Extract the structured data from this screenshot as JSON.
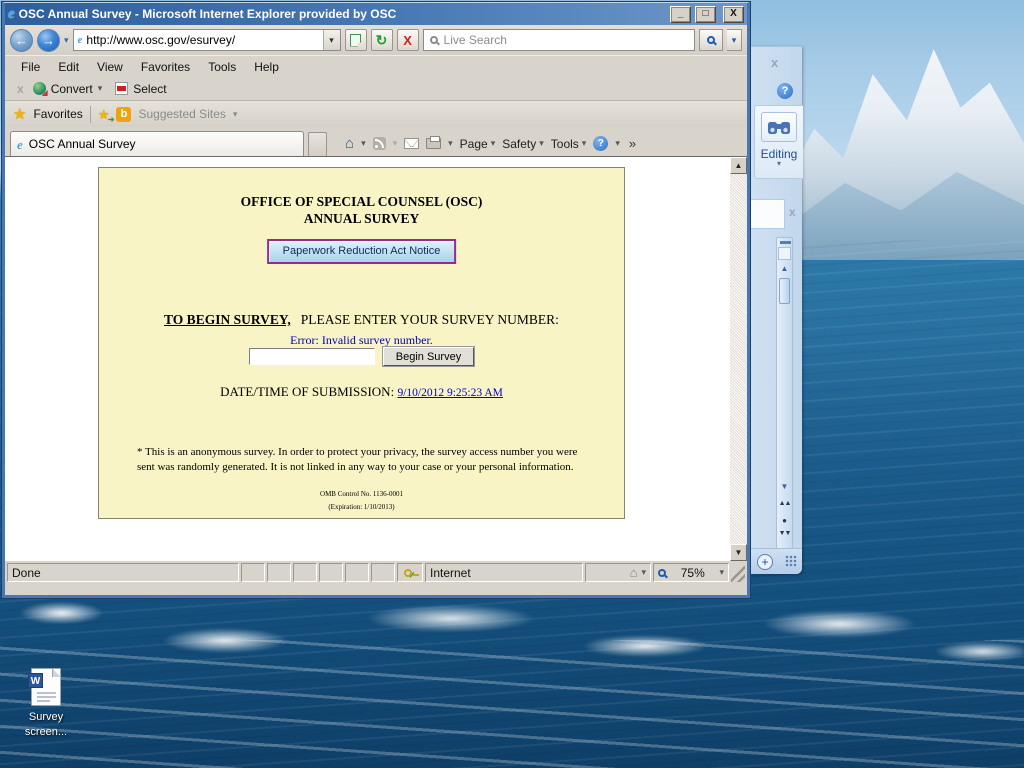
{
  "window": {
    "title": "OSC Annual Survey - Microsoft Internet Explorer provided by OSC",
    "minimize_glyph": "_",
    "maximize_glyph": "□",
    "close_glyph": "X"
  },
  "address_bar": {
    "url": "http://www.osc.gov/esurvey/",
    "search_placeholder": "Live Search",
    "back_glyph": "←",
    "forward_glyph": "→",
    "refresh_glyph": "↻",
    "stop_glyph": "X",
    "caret_glyph": "▾"
  },
  "menu": {
    "items": [
      "File",
      "Edit",
      "View",
      "Favorites",
      "Tools",
      "Help"
    ]
  },
  "convert_bar": {
    "disabled_close": "x",
    "convert_label": "Convert",
    "select_label": "Select",
    "caret_glyph": "▾"
  },
  "favorites_bar": {
    "star_glyph": "★",
    "favorites_label": "Favorites",
    "b_glyph": "b",
    "suggested_label": "Suggested Sites",
    "caret_glyph": "▾"
  },
  "tab_bar": {
    "active_tab": "OSC Annual Survey",
    "home_glyph": "⌂",
    "page_label": "Page",
    "safety_label": "Safety",
    "tools_label": "Tools",
    "help_glyph": "?",
    "overflow_glyph": "»",
    "caret_glyph": "▾"
  },
  "scrollbar": {
    "up_glyph": "▲",
    "down_glyph": "▼"
  },
  "page": {
    "title_line1": "OFFICE OF SPECIAL COUNSEL (OSC)",
    "title_line2": "ANNUAL SURVEY",
    "pra_button": "Paperwork Reduction Act Notice",
    "begin_bold": "TO BEGIN SURVEY,",
    "begin_rest": "PLEASE ENTER YOUR SURVEY NUMBER:",
    "error": "Error: Invalid survey number.",
    "survey_input_value": "",
    "begin_button": "Begin Survey",
    "datetime_label": "DATE/TIME OF SUBMISSION:",
    "datetime_link": "9/10/2012 9:25:23 AM",
    "disclaimer": "* This is an anonymous survey. In order to protect your privacy, the survey access number you were sent was randomly generated. It is not linked in any way to your case or your personal information.",
    "omb_line1": "OMB Control No. 1136-0001",
    "omb_line2": "(Expiration: 1/10/2013)"
  },
  "status_bar": {
    "left": "Done",
    "zone": "Internet",
    "zoom": "75%",
    "check_glyph": "✓",
    "house_glyph": "⌂",
    "caret_glyph": "▾"
  },
  "word_panel": {
    "close_glyph": "x",
    "help_glyph": "?",
    "editing_label": "Editing",
    "caret_glyph": "▾",
    "up_glyph": "▲",
    "down_glyph": "▼",
    "page_up_glyph": "▲▲",
    "browse_glyph": "●",
    "page_down_glyph": "▼▼",
    "zoom_plus_glyph": "+"
  },
  "desktop": {
    "icon_label_line1": "Survey",
    "icon_label_line2": "screen..."
  },
  "colors": {
    "titlebar_blue": "#3a6ea5",
    "frame_blue": "#4877b2",
    "toolbar_gray": "#d8d4cb",
    "survey_bg": "#f8f4c6",
    "pra_border": "#912d91",
    "link_blue": "#0000cc",
    "error_blue": "#0000bf",
    "word_panel_blue": "#cfe0f2"
  }
}
